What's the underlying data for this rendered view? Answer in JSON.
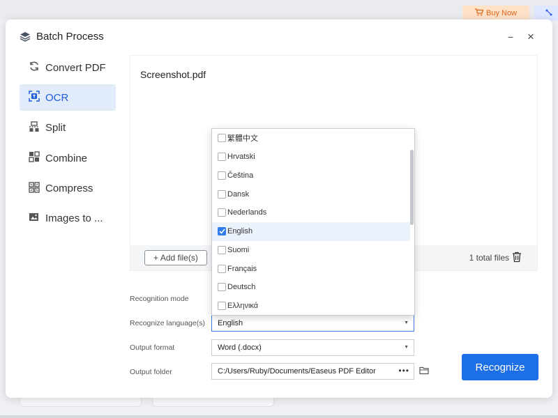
{
  "top_bar": {
    "buy_now_label": "Buy Now",
    "accent_color": "#e0631c"
  },
  "dialog": {
    "title": "Batch Process",
    "minimize_label": "−",
    "close_label": "×"
  },
  "sidebar": {
    "items": [
      {
        "label": "Convert PDF",
        "icon": "convert-icon",
        "active": false
      },
      {
        "label": "OCR",
        "icon": "ocr-icon",
        "active": true
      },
      {
        "label": "Split",
        "icon": "split-icon",
        "active": false
      },
      {
        "label": "Combine",
        "icon": "combine-icon",
        "active": false
      },
      {
        "label": "Compress",
        "icon": "compress-icon",
        "active": false
      },
      {
        "label": "Images to ...",
        "icon": "images-icon",
        "active": false
      }
    ]
  },
  "files": {
    "list": [
      "Screenshot.pdf"
    ],
    "add_label": "+ Add file(s)",
    "total_label": "1 total files"
  },
  "form": {
    "recognition_mode_label": "Recognition mode",
    "language_label": "Recognize language(s)",
    "language_value": "English",
    "output_format_label": "Output format",
    "output_format_value": "Word (.docx)",
    "output_folder_label": "Output folder",
    "output_folder_value": "C:/Users/Ruby/Documents/Easeus PDF Editor",
    "folder_more_label": "•••"
  },
  "language_dropdown": {
    "options": [
      {
        "label": "繁體中文",
        "checked": false
      },
      {
        "label": "Hrvatski",
        "checked": false
      },
      {
        "label": "Čeština",
        "checked": false
      },
      {
        "label": "Dansk",
        "checked": false
      },
      {
        "label": "Nederlands",
        "checked": false
      },
      {
        "label": "English",
        "checked": true
      },
      {
        "label": "Suomi",
        "checked": false
      },
      {
        "label": "Français",
        "checked": false
      },
      {
        "label": "Deutsch",
        "checked": false
      },
      {
        "label": "Ελληνικά",
        "checked": false
      }
    ]
  },
  "actions": {
    "recognize_label": "Recognize",
    "primary_color": "#1d6fe8"
  }
}
